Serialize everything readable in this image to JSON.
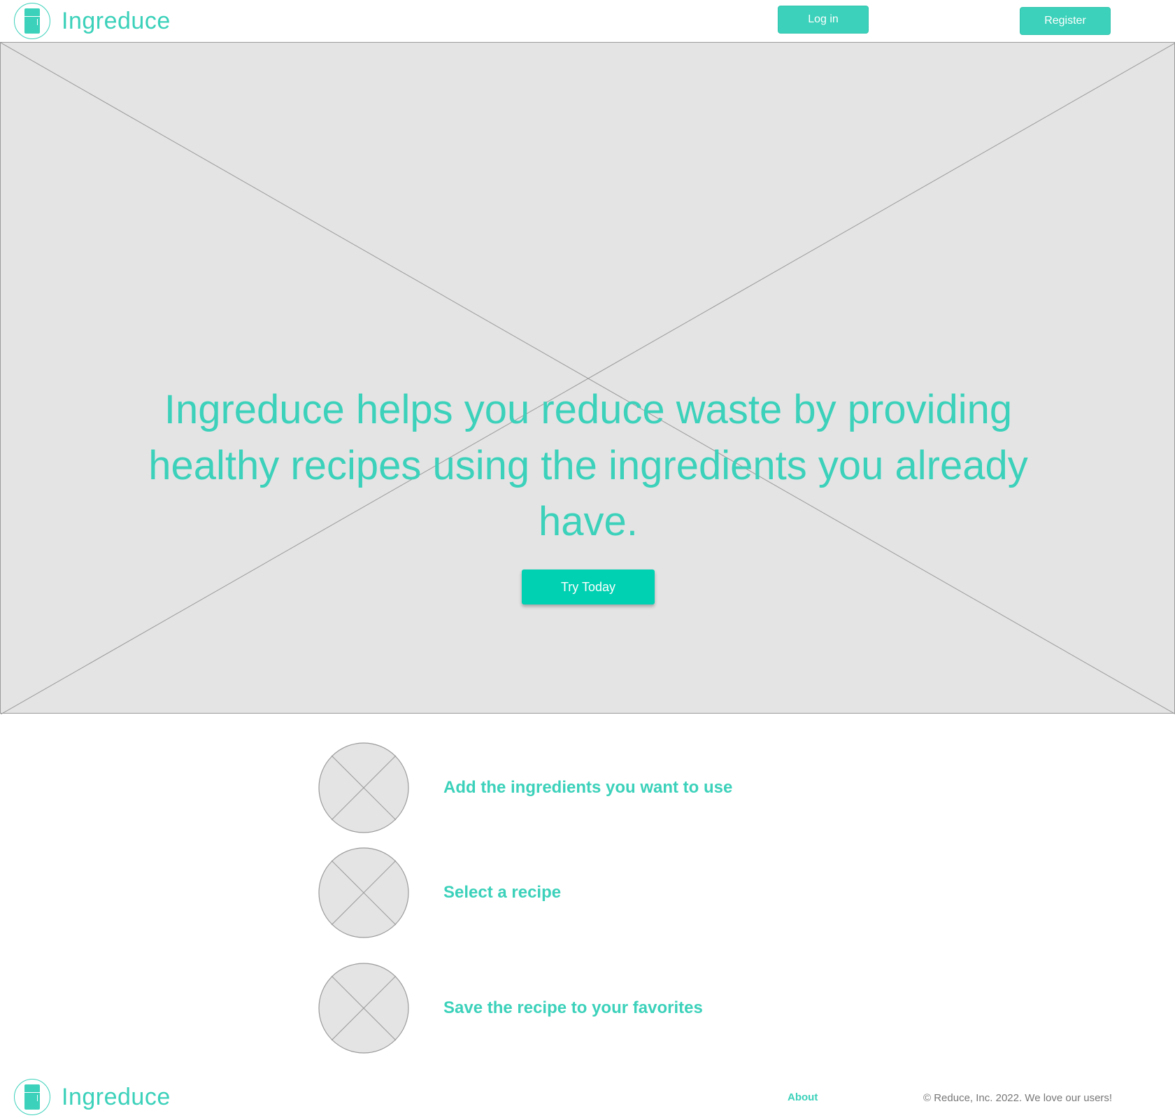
{
  "header": {
    "brand": "Ingreduce",
    "login_label": "Log in",
    "register_label": "Register"
  },
  "hero": {
    "headline": "Ingreduce helps you reduce waste by providing healthy recipes using the ingredients you already have.",
    "cta_label": "Try Today"
  },
  "steps": [
    {
      "label": "Add the ingredients you want to use"
    },
    {
      "label": "Select a recipe"
    },
    {
      "label": "Save the recipe to your favorites"
    }
  ],
  "footer": {
    "brand": "Ingreduce",
    "about_label": "About",
    "copyright": "© Reduce, Inc. 2022. We love our users!"
  },
  "colors": {
    "brand": "#3bd1ba",
    "cta": "#00d1b2",
    "placeholder_fill": "#e4e4e4",
    "placeholder_stroke": "#9a9a9a"
  },
  "icons": {
    "logo": "fridge-icon",
    "step_image": "image-placeholder-icon"
  }
}
